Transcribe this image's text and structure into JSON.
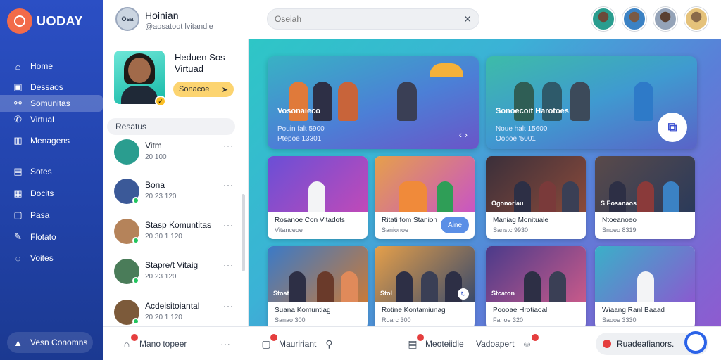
{
  "brand": {
    "name": "UODAY"
  },
  "nav": {
    "items": [
      {
        "label": "Home",
        "icon": "home-icon"
      },
      {
        "label": "Dessaos",
        "icon": "inbox-icon"
      },
      {
        "label": "Somunitas",
        "icon": "community-icon"
      },
      {
        "label": "Virtual",
        "icon": "phone-icon"
      },
      {
        "label": "Menagens",
        "icon": "building-icon"
      },
      {
        "label": "Sotes",
        "icon": "notes-icon"
      },
      {
        "label": "Docits",
        "icon": "document-icon"
      },
      {
        "label": "Pasa",
        "icon": "page-icon"
      },
      {
        "label": "Flotato",
        "icon": "edit-icon"
      },
      {
        "label": "Voites",
        "icon": "vote-icon"
      }
    ],
    "active_index": 2,
    "bottom_label": "Vesn Conomns"
  },
  "user": {
    "initials": "Osa",
    "name": "Hoinian",
    "handle": "@aosatoot lvitandie"
  },
  "search": {
    "placeholder": "Oseiah"
  },
  "profile": {
    "title": "Heduen Sos Virtuad",
    "button": "Sonacoe"
  },
  "contacts": {
    "header": "Resatus",
    "items": [
      {
        "name": "Vitm",
        "time": "20 100",
        "color": "#2a9d8f"
      },
      {
        "name": "Bona",
        "time": "20 23 120",
        "color": "#3b5998"
      },
      {
        "name": "Stasp Komuntitas",
        "time": "20 30 1 120",
        "color": "#b5835a"
      },
      {
        "name": "Stapre/t Vitaig",
        "time": "20 23 120",
        "color": "#4a7c59"
      },
      {
        "name": "Acdeisitoiantal",
        "time": "20 20 1 120",
        "color": "#7c5a3a"
      }
    ]
  },
  "featured": [
    {
      "title": "Vosonaieco",
      "meta1": "Pouin falt 5900",
      "meta2": "Ptepoe 13301"
    },
    {
      "title": "Sonoecoit Harotoes",
      "meta1": "Noue halt 15600",
      "meta2": "Oopoe '5001"
    }
  ],
  "cards": [
    {
      "tag": "",
      "name": "Rosanoe Con Vitadots",
      "sub": "Vitanceoe",
      "pill": ""
    },
    {
      "tag": "",
      "name": "Ritati fom Stanion",
      "sub": "Sanionoe",
      "pill": "Aine"
    },
    {
      "tag": "Ogonoriau",
      "name": "Maniag Monituale",
      "sub": "Sanstc 9930",
      "pill": ""
    },
    {
      "tag": "S Eosanaos",
      "name": "Ntoeanoeo",
      "sub": "Snoeo 8319",
      "pill": ""
    },
    {
      "tag": "Stoat",
      "name": "Suana Komuntiag",
      "sub": "Sanao 300",
      "pill": ""
    },
    {
      "tag": "Stol",
      "name": "Rotine Kontamiunag",
      "sub": "Roarc 300",
      "pill": ""
    },
    {
      "tag": "Stcaton",
      "name": "Poooae Hrotiaoal",
      "sub": "Fanoe 320",
      "pill": ""
    },
    {
      "tag": "",
      "name": "Wiaang Ranl Baaad",
      "sub": "Saooe 3330",
      "pill": ""
    }
  ],
  "bottom": {
    "item1": "Mano topeer",
    "item2": "Mauririant",
    "item3": "Meoteiidie",
    "item4": "Vadoapert",
    "notification": "Ruadeafianors."
  },
  "colors": {
    "nav_bg": "#2142a8",
    "accent_yellow": "#fcd470",
    "accent_blue": "#2b63e8"
  }
}
